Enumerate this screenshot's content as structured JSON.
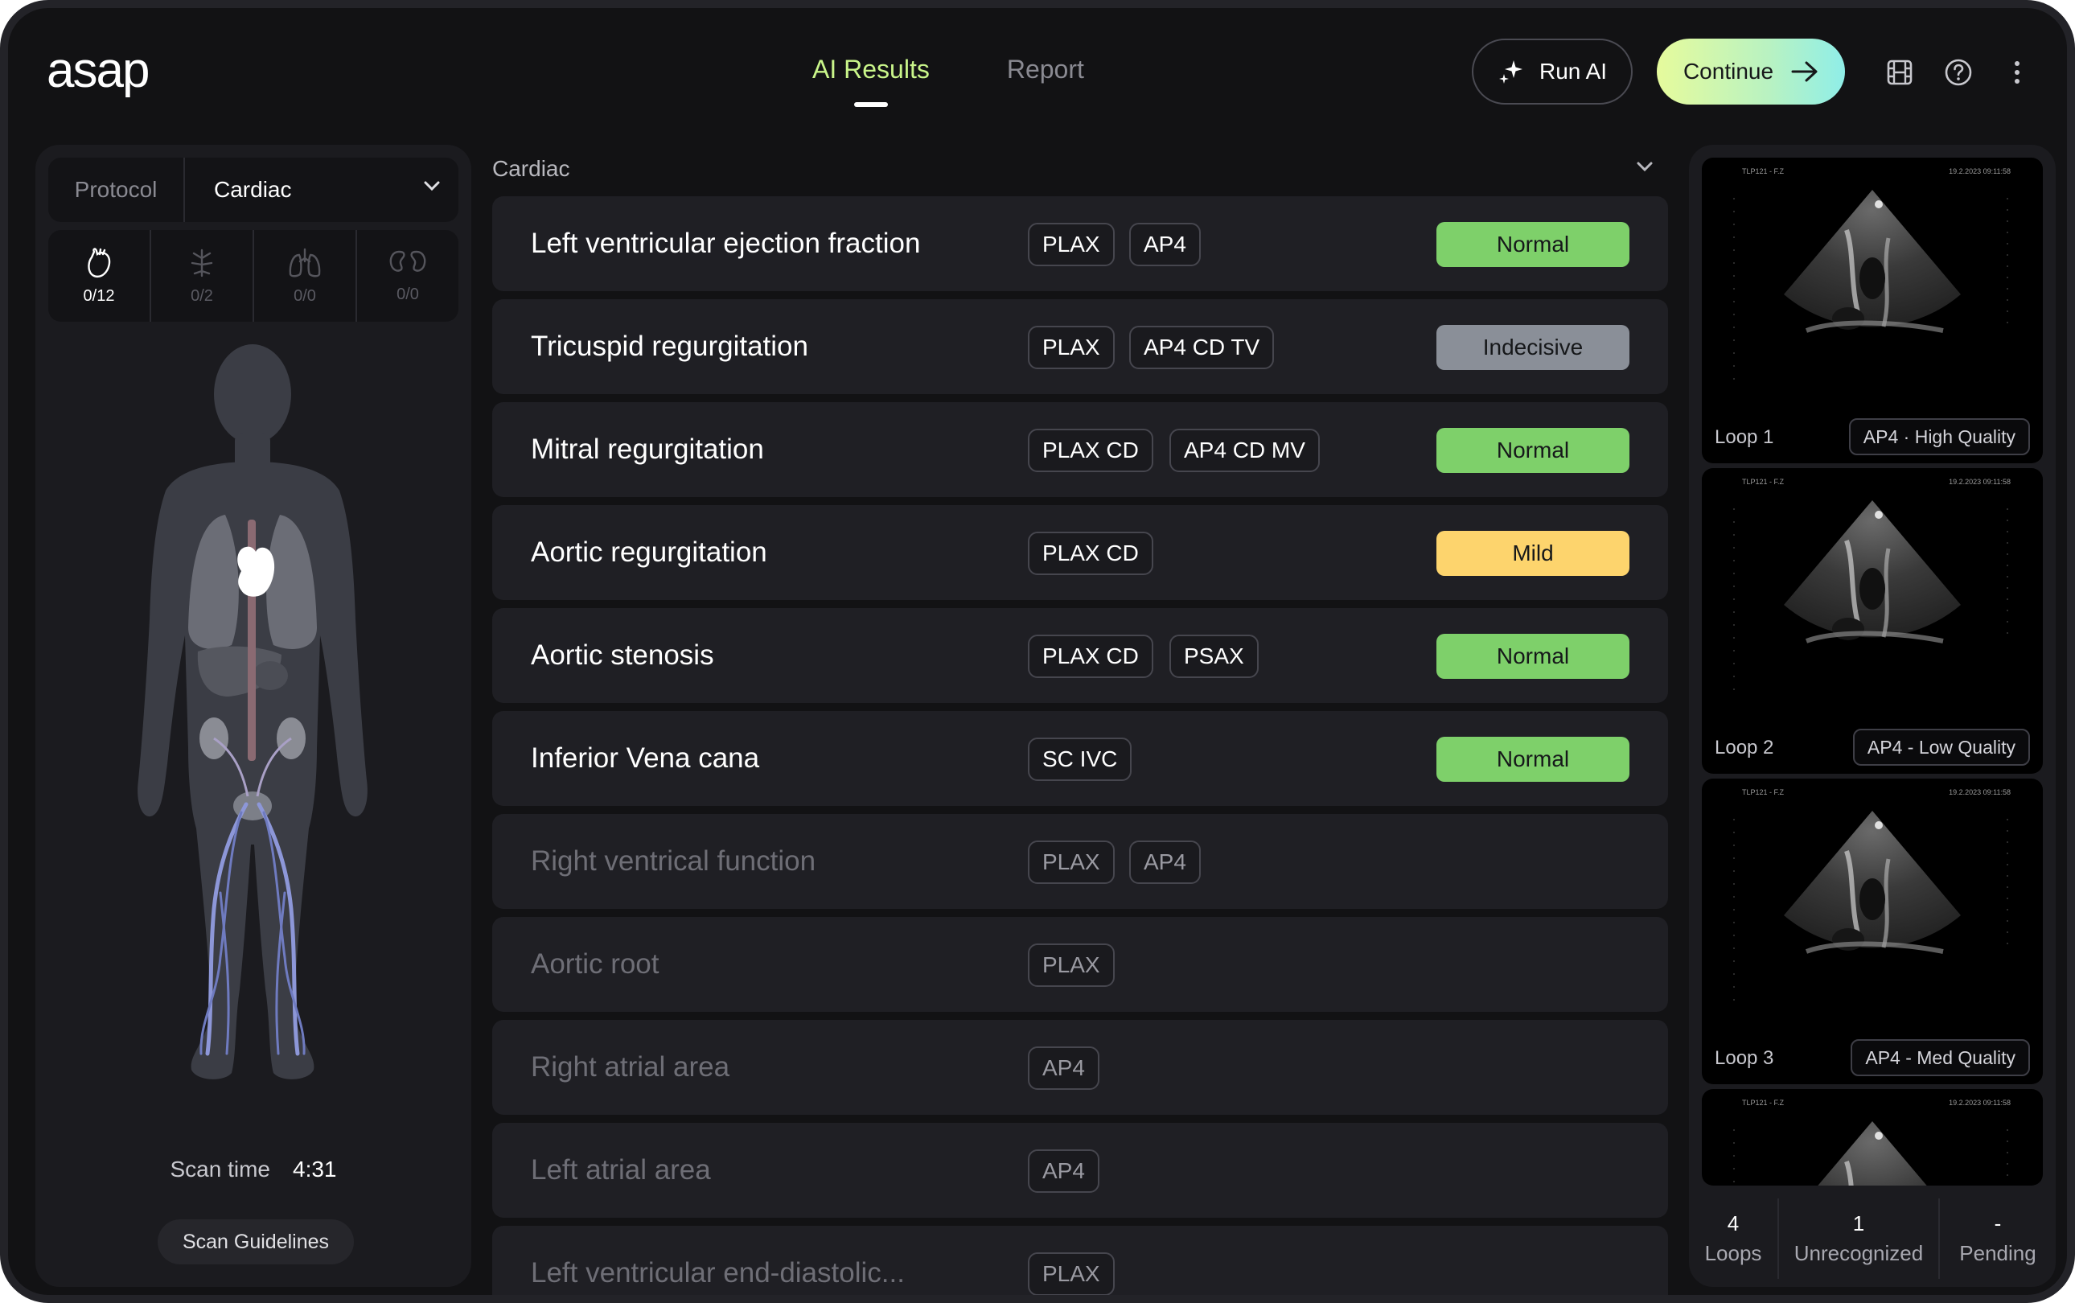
{
  "app": {
    "logo_text": "asap"
  },
  "nav": {
    "tabs": [
      {
        "label": "AI Results",
        "active": true
      },
      {
        "label": "Report",
        "active": false
      }
    ],
    "run_ai_label": "Run AI",
    "continue_label": "Continue"
  },
  "left_panel": {
    "protocol_label": "Protocol",
    "protocol_value": "Cardiac",
    "organs": [
      {
        "icon": "heart-icon",
        "count": "0/12"
      },
      {
        "icon": "liver-icon",
        "count": "0/2"
      },
      {
        "icon": "lungs-icon",
        "count": "0/0"
      },
      {
        "icon": "kidneys-icon",
        "count": "0/0"
      }
    ],
    "scan_time_label": "Scan time",
    "scan_time_value": "4:31",
    "guidelines_label": "Scan Guidelines"
  },
  "results": {
    "section_title": "Cardiac",
    "rows": [
      {
        "name": "Left ventricular ejection fraction",
        "views": [
          "PLAX",
          "AP4"
        ],
        "status": "Normal"
      },
      {
        "name": "Tricuspid regurgitation",
        "views": [
          "PLAX",
          "AP4 CD TV"
        ],
        "status": "Indecisive"
      },
      {
        "name": "Mitral regurgitation",
        "views": [
          "PLAX CD",
          "AP4 CD MV"
        ],
        "status": "Normal"
      },
      {
        "name": "Aortic regurgitation",
        "views": [
          "PLAX CD"
        ],
        "status": "Mild"
      },
      {
        "name": "Aortic stenosis",
        "views": [
          "PLAX CD",
          "PSAX"
        ],
        "status": "Normal"
      },
      {
        "name": "Inferior Vena cana",
        "views": [
          "SC IVC"
        ],
        "status": "Normal"
      },
      {
        "name": "Right ventrical function",
        "views": [
          "PLAX",
          "AP4"
        ],
        "status": ""
      },
      {
        "name": "Aortic root",
        "views": [
          "PLAX"
        ],
        "status": ""
      },
      {
        "name": "Right atrial area",
        "views": [
          "AP4"
        ],
        "status": ""
      },
      {
        "name": "Left atrial area",
        "views": [
          "AP4"
        ],
        "status": ""
      },
      {
        "name": "Left ventricular end-diastolic...",
        "views": [
          "PLAX"
        ],
        "status": ""
      }
    ],
    "status_colors": {
      "Normal": "#7ed06a",
      "Indecisive": "#8a8f98",
      "Mild": "#fdd46d"
    }
  },
  "loops": {
    "items": [
      {
        "name": "Loop 1",
        "quality": "AP4 · High Quality",
        "overlay_left": "TLP121 - F.Z",
        "overlay_right": "19.2.2023 09:11:58"
      },
      {
        "name": "Loop 2",
        "quality": "AP4 - Low Quality",
        "overlay_left": "TLP121 - F.Z",
        "overlay_right": "19.2.2023 09:11:58"
      },
      {
        "name": "Loop 3",
        "quality": "AP4 - Med Quality",
        "overlay_left": "TLP121 - F.Z",
        "overlay_right": "19.2.2023 09:11:58"
      },
      {
        "name": "",
        "quality": "",
        "overlay_left": "TLP121 - F.Z",
        "overlay_right": "19.2.2023 09:11:58"
      }
    ],
    "stats": [
      {
        "value": "4",
        "label": "Loops"
      },
      {
        "value": "1",
        "label": "Unrecognized"
      },
      {
        "value": "-",
        "label": "Pending"
      }
    ]
  }
}
